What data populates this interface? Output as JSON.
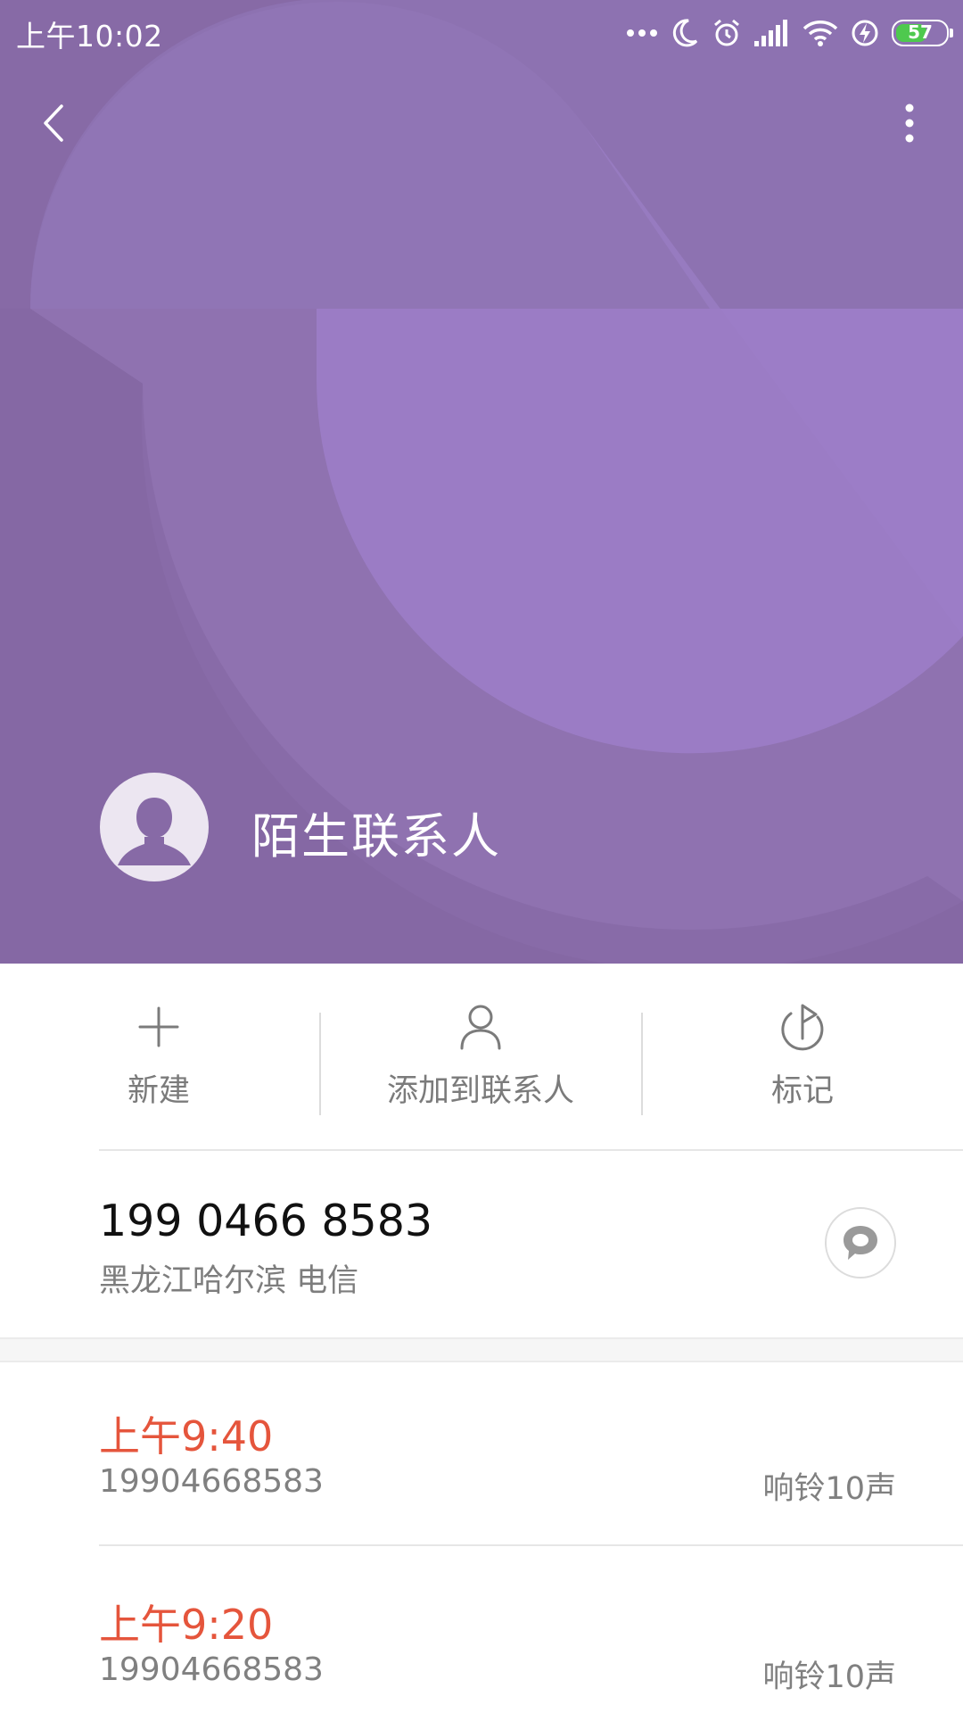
{
  "status_bar": {
    "time": "上午10:02",
    "battery_level": "57",
    "icons": [
      "more-dots-icon",
      "moon-icon",
      "alarm-icon",
      "signal-icon",
      "wifi-icon",
      "charging-icon",
      "battery-icon"
    ]
  },
  "header": {
    "background_color": "#876aa6",
    "contact_name": "陌生联系人"
  },
  "actions": [
    {
      "label": "新建",
      "icon": "plus-icon"
    },
    {
      "label": "添加到联系人",
      "icon": "person-icon"
    },
    {
      "label": "标记",
      "icon": "flag-icon"
    }
  ],
  "phone": {
    "number": "199 0466 8583",
    "location": "黑龙江哈尔滨 电信"
  },
  "calls": [
    {
      "time": "上午9:40",
      "number": "19904668583",
      "ring": "响铃10声"
    },
    {
      "time": "上午9:20",
      "number": "19904668583",
      "ring": "响铃10声"
    }
  ],
  "colors": {
    "accent_missed": "#e5553c",
    "header_purple": "#876aa6"
  }
}
